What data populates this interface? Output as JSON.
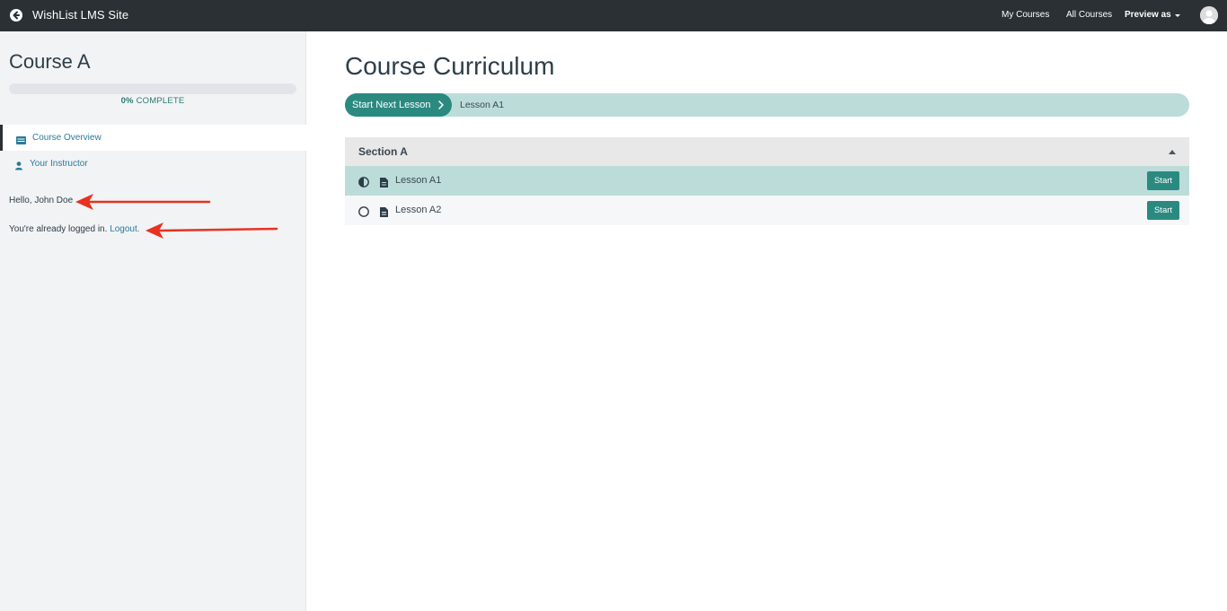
{
  "topbar": {
    "site_title": "WishList LMS Site",
    "links": {
      "my_courses": "My Courses",
      "all_courses": "All Courses",
      "preview_as": "Preview as"
    }
  },
  "sidebar": {
    "course_title": "Course A",
    "progress": {
      "percent": 0,
      "percent_label": "0%",
      "complete_label": "COMPLETE"
    },
    "nav": [
      {
        "label": "Course Overview",
        "icon": "list-icon",
        "active": true
      },
      {
        "label": "Your Instructor",
        "icon": "user-icon",
        "active": false
      }
    ],
    "greeting": "Hello, John Doe",
    "logged_in_text": "You're already logged in.",
    "logout_label": "Logout."
  },
  "main": {
    "title": "Course Curriculum",
    "next_lesson": {
      "button_label": "Start Next Lesson",
      "lesson_name": "Lesson A1"
    },
    "sections": [
      {
        "title": "Section A",
        "lessons": [
          {
            "label": "Lesson A1",
            "status": "in-progress",
            "button": "Start"
          },
          {
            "label": "Lesson A2",
            "status": "not-started",
            "button": "Start"
          }
        ]
      }
    ]
  },
  "colors": {
    "topbar_bg": "#2a3033",
    "accent": "#2b8a80",
    "accent_light": "#bcdcda",
    "link": "#2b7a9a",
    "annotation_arrow": "#e8321f"
  }
}
